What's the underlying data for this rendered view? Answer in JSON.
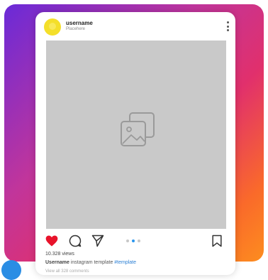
{
  "post": {
    "username": "username",
    "location": "Placehere",
    "views": "10.328 views",
    "caption_user": "Username",
    "caption_text": " instagram template ",
    "caption_hashtag": "#template",
    "comments_link": "View all 328 comments"
  },
  "carousel": {
    "count": 3,
    "active_index": 1
  },
  "colors": {
    "like": "#e8132b",
    "accent_blue": "#2a96ee",
    "gradient": [
      "#6a2ad8",
      "#c1359b",
      "#e1306c",
      "#fa6a2a",
      "#fd8d1f"
    ]
  },
  "icons": {
    "avatar": "avatar-icon",
    "more": "more-vertical-icon",
    "image_placeholder": "image-placeholder-icon",
    "like": "heart-icon",
    "comment": "comment-icon",
    "share": "send-icon",
    "save": "bookmark-icon"
  }
}
